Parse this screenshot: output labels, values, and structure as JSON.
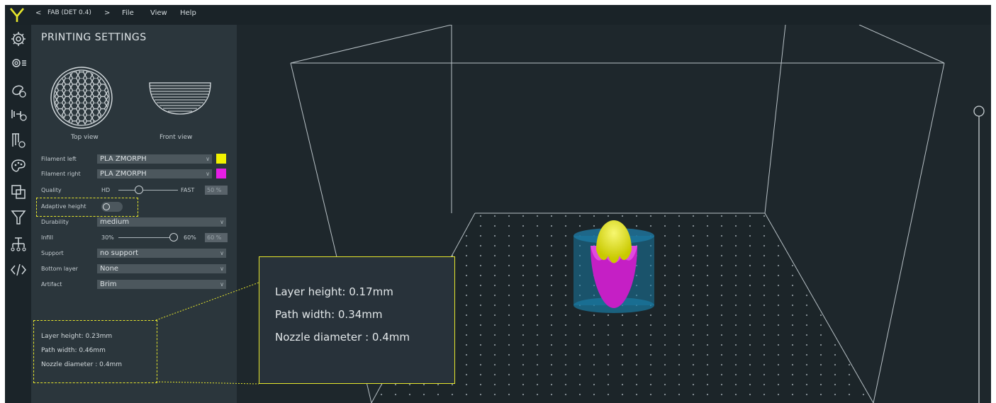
{
  "menubar": {
    "profile": "FAB (DET 0.4)",
    "items": [
      "File",
      "View",
      "Help"
    ],
    "nav_left": "<",
    "nav_right": ">"
  },
  "iconbar": {
    "icons": [
      "gear-icon",
      "settings-list-icon",
      "material-palette-icon",
      "tools-icon",
      "filter-gear-icon",
      "palette-icon",
      "copy-icon",
      "funnel-icon",
      "hierarchy-icon",
      "code-icon"
    ]
  },
  "panel": {
    "title": "PRINTING SETTINGS",
    "top_view_label": "Top view",
    "front_view_label": "Front view",
    "filament_left": {
      "label": "Filament left",
      "value": "PLA ZMORPH",
      "color": "#f2f200"
    },
    "filament_right": {
      "label": "Filament right",
      "value": "PLA ZMORPH",
      "color": "#e61ee6"
    },
    "quality": {
      "label": "Quality",
      "min_label": "HD",
      "max_label": "FAST",
      "value": "50 %",
      "level": 0.35
    },
    "adaptive_height": {
      "label": "Adaptive height",
      "on": false
    },
    "durability": {
      "label": "Durability",
      "value": "medium"
    },
    "infill": {
      "label": "Infill",
      "min_label": "30%",
      "max_label": "60%",
      "value": "60 %",
      "level": 1.0
    },
    "support": {
      "label": "Support",
      "value": "no support"
    },
    "bottom_layer": {
      "label": "Bottom layer",
      "value": "None"
    },
    "artifact": {
      "label": "Artifact",
      "value": "Brim"
    },
    "info": {
      "layer_height": "Layer height: 0.23mm",
      "path_width": "Path width: 0.46mm",
      "nozzle": "Nozzle diameter : 0.4mm"
    }
  },
  "callout": {
    "layer_height": "Layer height: 0.17mm",
    "path_width": "Path width: 0.34mm",
    "nozzle": "Nozzle diameter : 0.4mm"
  },
  "colors": {
    "accent": "#e6e62c",
    "highlight": "#e6e62c",
    "magenta": "#e61ee6",
    "yellow": "#f2f200"
  }
}
